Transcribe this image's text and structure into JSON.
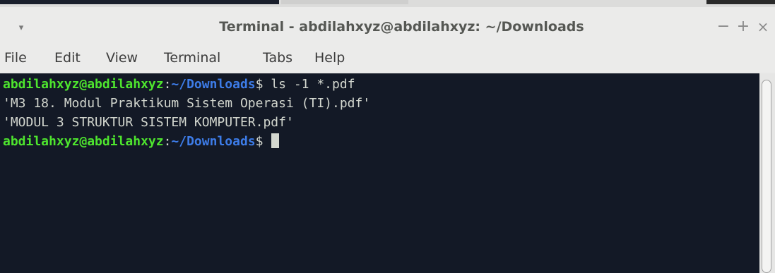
{
  "window": {
    "title": "Terminal - abdilahxyz@abdilahxyz: ~/Downloads",
    "menu_icon": "▾",
    "controls": {
      "minimize": "−",
      "maximize": "+",
      "close": "×"
    }
  },
  "menubar": {
    "items": [
      "File",
      "Edit",
      "View",
      "Terminal",
      "Tabs",
      "Help"
    ]
  },
  "terminal": {
    "colors": {
      "background": "#131926",
      "user": "#4ee52e",
      "path": "#3d7ce8",
      "text": "#d3d7cf"
    },
    "line1": {
      "user": "abdilahxyz@abdilahxyz",
      "colon": ":",
      "path": "~/Downloads",
      "sign": "$",
      "command": " ls -1 *.pdf"
    },
    "output": [
      "'M3 18. Modul Praktikum Sistem Operasi (TI).pdf'",
      "'MODUL 3 STRUKTUR SISTEM KOMPUTER.pdf'"
    ],
    "line4": {
      "user": "abdilahxyz@abdilahxyz",
      "colon": ":",
      "path": "~/Downloads",
      "sign": "$",
      "command": " "
    }
  }
}
